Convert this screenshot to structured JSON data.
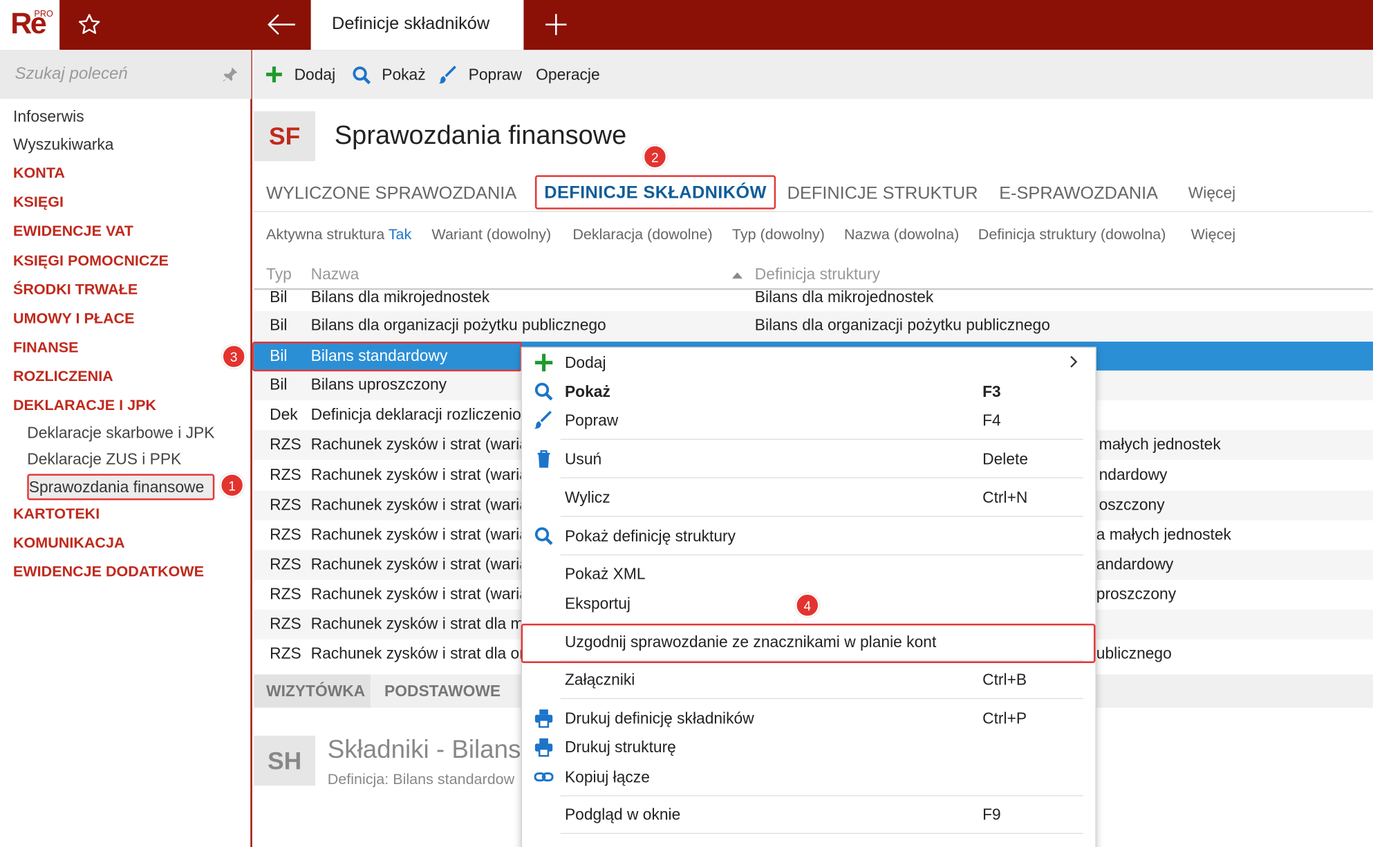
{
  "app": {
    "logo": "Re",
    "logo_badge": "PRO",
    "tab_title": "Definicje składników"
  },
  "sidebar": {
    "search_placeholder": "Szukaj poleceń",
    "items": [
      {
        "label": "Infoserwis",
        "kind": "plain"
      },
      {
        "label": "Wyszukiwarka",
        "kind": "plain"
      },
      {
        "label": "KONTA",
        "kind": "cat"
      },
      {
        "label": "KSIĘGI",
        "kind": "cat"
      },
      {
        "label": "EWIDENCJE VAT",
        "kind": "cat"
      },
      {
        "label": "KSIĘGI POMOCNICZE",
        "kind": "cat"
      },
      {
        "label": "ŚRODKI TRWAŁE",
        "kind": "cat"
      },
      {
        "label": "UMOWY I PŁACE",
        "kind": "cat"
      },
      {
        "label": "FINANSE",
        "kind": "cat"
      },
      {
        "label": "ROZLICZENIA",
        "kind": "cat"
      },
      {
        "label": "DEKLARACJE I JPK",
        "kind": "cat"
      },
      {
        "label": "Deklaracje skarbowe i JPK",
        "kind": "sub"
      },
      {
        "label": "Deklaracje ZUS i PPK",
        "kind": "sub"
      },
      {
        "label": "Sprawozdania finansowe",
        "kind": "sel"
      },
      {
        "label": "KARTOTEKI",
        "kind": "cat"
      },
      {
        "label": "KOMUNIKACJA",
        "kind": "cat"
      },
      {
        "label": "EWIDENCJE DODATKOWE",
        "kind": "cat"
      }
    ]
  },
  "toolbar": {
    "add": "Dodaj",
    "show": "Pokaż",
    "edit": "Popraw",
    "ops": "Operacje"
  },
  "header": {
    "abbr": "SF",
    "title": "Sprawozdania finansowe"
  },
  "tabs": {
    "t1": "WYLICZONE SPRAWOZDANIA",
    "t2": "DEFINICJE SKŁADNIKÓW",
    "t3": "DEFINICJE STRUKTUR",
    "t4": "E-SPRAWOZDANIA",
    "more": "Więcej"
  },
  "filters": {
    "f1_label": "Aktywna struktura",
    "f1_value": "Tak",
    "f2": "Wariant (dowolny)",
    "f3": "Deklaracja (dowolne)",
    "f4": "Typ (dowolny)",
    "f5": "Nazwa (dowolna)",
    "f6": "Definicja struktury (dowolna)",
    "more": "Więcej"
  },
  "grid": {
    "headers": {
      "type": "Typ",
      "name": "Nazwa",
      "def": "Definicja struktury"
    },
    "rows": [
      {
        "type": "Bil",
        "name": "Bilans dla mikrojednostek",
        "def": "Bilans dla mikrojednostek"
      },
      {
        "type": "Bil",
        "name": "Bilans dla organizacji pożytku publicznego",
        "def": "Bilans dla organizacji pożytku publicznego"
      },
      {
        "type": "Bil",
        "name": "Bilans standardowy",
        "def": ""
      },
      {
        "type": "Bil",
        "name": "Bilans uproszczony",
        "def": ""
      },
      {
        "type": "Dek",
        "name": "Definicja deklaracji rozliczeniow",
        "def": ""
      },
      {
        "type": "RZS",
        "name": "Rachunek zysków i strat (waria",
        "def": "małych jednostek"
      },
      {
        "type": "RZS",
        "name": "Rachunek zysków i strat (waria",
        "def": "ndardowy"
      },
      {
        "type": "RZS",
        "name": "Rachunek zysków i strat (waria",
        "def": "oszczony"
      },
      {
        "type": "RZS",
        "name": "Rachunek zysków i strat (waria",
        "def": "a małych jednostek"
      },
      {
        "type": "RZS",
        "name": "Rachunek zysków i strat (waria",
        "def": "andardowy"
      },
      {
        "type": "RZS",
        "name": "Rachunek zysków i strat (waria",
        "def": "proszczony"
      },
      {
        "type": "RZS",
        "name": "Rachunek zysków i strat dla mi",
        "def": ""
      },
      {
        "type": "RZS",
        "name": "Rachunek zysków i strat dla or",
        "def": "ublicznego"
      }
    ]
  },
  "bottom": {
    "tab1": "WIZYTÓWKA",
    "tab2": "PODSTAWOWE",
    "abbr": "SH",
    "title": "Składniki - Bilans",
    "subtitle": "Definicja: Bilans standardow"
  },
  "menu": {
    "add": "Dodaj",
    "show": "Pokaż",
    "show_key": "F3",
    "edit": "Popraw",
    "edit_key": "F4",
    "delete": "Usuń",
    "delete_key": "Delete",
    "calc": "Wylicz",
    "calc_key": "Ctrl+N",
    "show_def": "Pokaż definicję struktury",
    "show_xml": "Pokaż XML",
    "export": "Eksportuj",
    "reconcile": "Uzgodnij sprawozdanie ze znacznikami w planie kont",
    "attach": "Załączniki",
    "attach_key": "Ctrl+B",
    "print_def": "Drukuj definicję składników",
    "print_def_key": "Ctrl+P",
    "print_struct": "Drukuj strukturę",
    "copy_link": "Kopiuj łącze",
    "preview": "Podgląd w oknie",
    "preview_key": "F9"
  },
  "badges": {
    "b1": "1",
    "b2": "2",
    "b3": "3",
    "b4": "4"
  },
  "colors": {
    "brand": "#8b1106",
    "accent_red": "#c0291d",
    "selection": "#2b8fd6",
    "tab_selected": "#0f5d99",
    "callout": "#e3332f"
  }
}
